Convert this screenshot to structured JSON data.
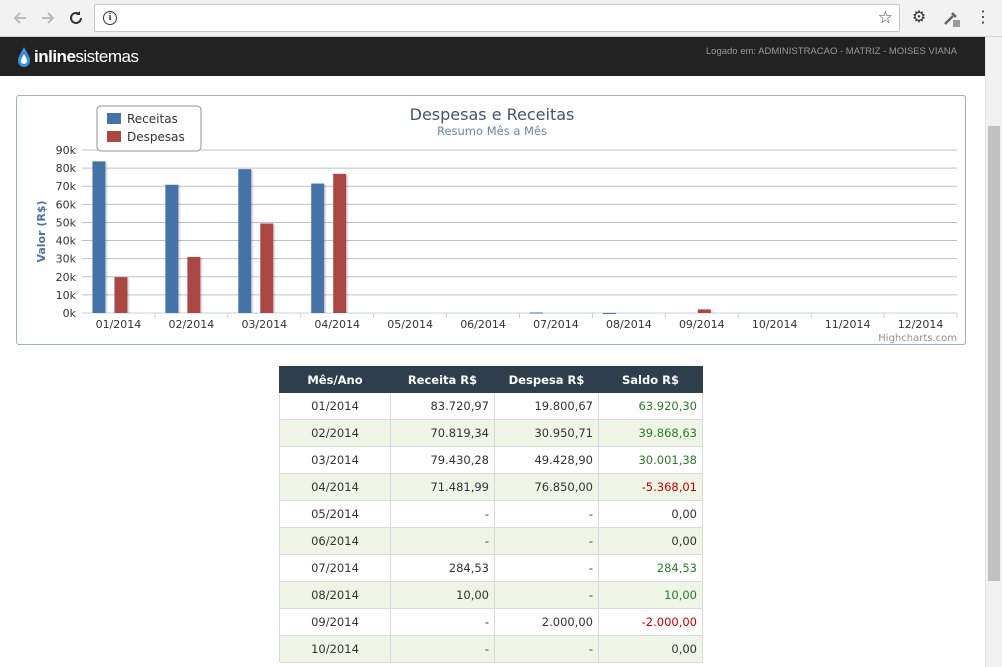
{
  "browser": {
    "url": "",
    "icons": [
      "back-icon",
      "forward-icon",
      "reload-icon",
      "info-icon",
      "star-icon",
      "gear-icon",
      "eyedropper-icon",
      "more-vert-icon"
    ]
  },
  "header": {
    "logo_bold": "inline",
    "logo_light": "sistemas",
    "logged_in": "Logado em: ADMINISTRACAO - MATRIZ - MOISES VIANA"
  },
  "colors": {
    "receitas": "#4572a7",
    "despesas": "#aa4643",
    "header_bg": "#222222",
    "table_header": "#2f3e4c",
    "alt_row": "#eef5e6",
    "positive": "#2a7a2a",
    "negative": "#c00000"
  },
  "chart_data": {
    "type": "bar",
    "title": "Despesas e Receitas",
    "subtitle": "Resumo Mês a Mês",
    "ylabel": "Valor (R$)",
    "xlabel": "",
    "ylim": [
      0,
      90000
    ],
    "yticks": [
      "0k",
      "10k",
      "20k",
      "30k",
      "40k",
      "50k",
      "60k",
      "70k",
      "80k",
      "90k"
    ],
    "categories": [
      "01/2014",
      "02/2014",
      "03/2014",
      "04/2014",
      "05/2014",
      "06/2014",
      "07/2014",
      "08/2014",
      "09/2014",
      "10/2014",
      "11/2014",
      "12/2014"
    ],
    "series": [
      {
        "name": "Receitas",
        "values": [
          83720.97,
          70819.34,
          79430.28,
          71481.99,
          0,
          0,
          284.53,
          10.0,
          0,
          0,
          0,
          0
        ]
      },
      {
        "name": "Despesas",
        "values": [
          19800.67,
          30950.71,
          49428.9,
          76850.0,
          0,
          0,
          0,
          0,
          2000.0,
          0,
          0,
          0
        ]
      }
    ],
    "legend": "top-left",
    "grid": true,
    "credits": "Highcharts.com"
  },
  "table": {
    "headers": [
      "Mês/Ano",
      "Receita R$",
      "Despesa R$",
      "Saldo R$"
    ],
    "rows": [
      {
        "mes": "01/2014",
        "receita": "83.720,97",
        "despesa": "19.800,67",
        "saldo": "63.920,30",
        "status": "pos"
      },
      {
        "mes": "02/2014",
        "receita": "70.819,34",
        "despesa": "30.950,71",
        "saldo": "39.868,63",
        "status": "pos"
      },
      {
        "mes": "03/2014",
        "receita": "79.430,28",
        "despesa": "49.428,90",
        "saldo": "30.001,38",
        "status": "pos"
      },
      {
        "mes": "04/2014",
        "receita": "71.481,99",
        "despesa": "76.850,00",
        "saldo": "-5.368,01",
        "status": "neg"
      },
      {
        "mes": "05/2014",
        "receita": "-",
        "despesa": "-",
        "saldo": "0,00",
        "status": "zero"
      },
      {
        "mes": "06/2014",
        "receita": "-",
        "despesa": "-",
        "saldo": "0,00",
        "status": "zero"
      },
      {
        "mes": "07/2014",
        "receita": "284,53",
        "despesa": "-",
        "saldo": "284,53",
        "status": "pos"
      },
      {
        "mes": "08/2014",
        "receita": "10,00",
        "despesa": "-",
        "saldo": "10,00",
        "status": "pos"
      },
      {
        "mes": "09/2014",
        "receita": "-",
        "despesa": "2.000,00",
        "saldo": "-2.000,00",
        "status": "neg"
      },
      {
        "mes": "10/2014",
        "receita": "-",
        "despesa": "-",
        "saldo": "0,00",
        "status": "zero"
      }
    ]
  }
}
